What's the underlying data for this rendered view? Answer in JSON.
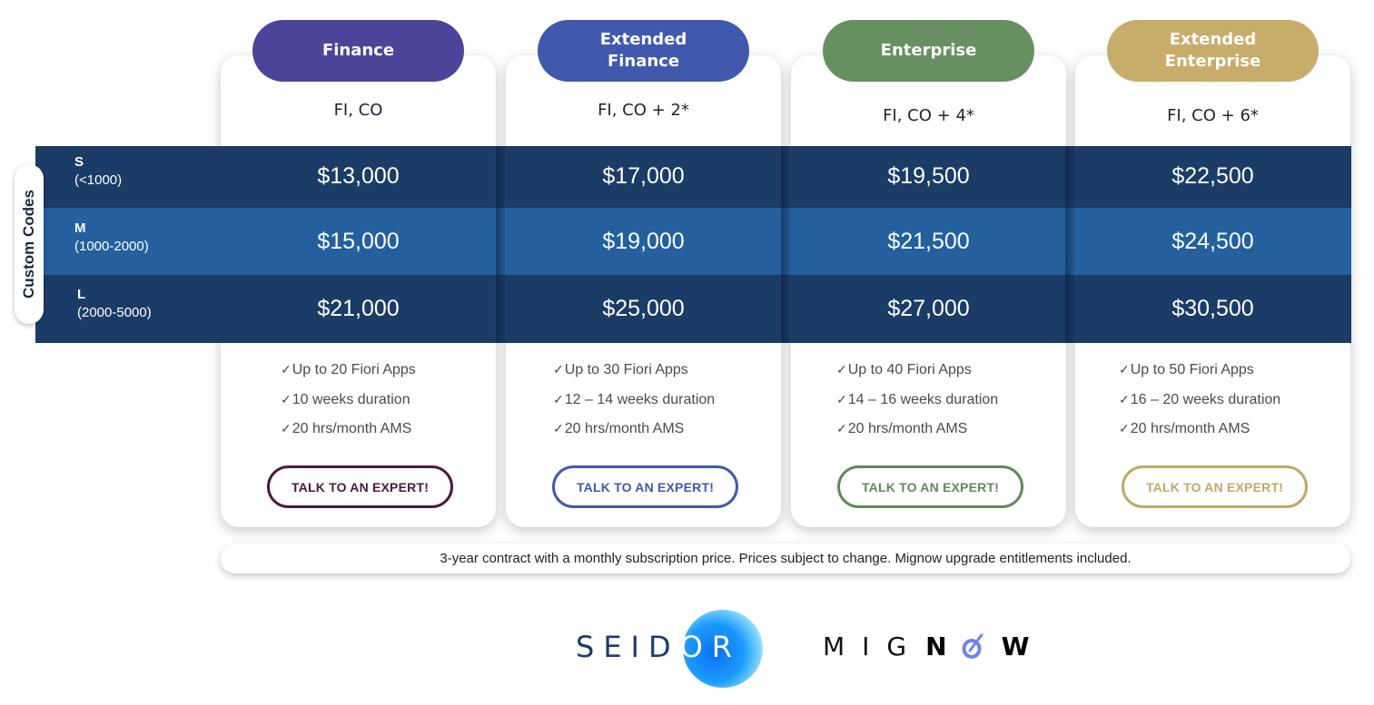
{
  "plans": [
    {
      "name": "Finance",
      "modules": "FI, CO",
      "color": "#4b459a",
      "prices": [
        "$13,000",
        "$15,000",
        "$21,000"
      ],
      "features": [
        "Up to 20 Fiori Apps",
        "10 weeks duration",
        "20 hrs/month AMS"
      ],
      "cta_label": "TALK TO AN EXPERT!",
      "cta_color": "#4a1a3f"
    },
    {
      "name": "Extended Finance",
      "modules": "FI, CO + 2*",
      "color": "#4059ad",
      "prices": [
        "$17,000",
        "$19,000",
        "$25,000"
      ],
      "features": [
        "Up to 30 Fiori Apps",
        "12 – 14 weeks duration",
        "20 hrs/month AMS"
      ],
      "cta_label": "TALK TO AN EXPERT!",
      "cta_color": "#4059ad"
    },
    {
      "name": "Enterprise",
      "modules": "FI, CO + 4*",
      "color": "#66905f",
      "prices": [
        "$19,500",
        "$21,500",
        "$27,000"
      ],
      "features": [
        "Up to 40 Fiori Apps",
        "14 – 16 weeks duration",
        "20 hrs/month AMS"
      ],
      "cta_label": "TALK TO AN EXPERT!",
      "cta_color": "#5f8a58"
    },
    {
      "name": "Extended Enterprise",
      "modules": "FI, CO + 6*",
      "color": "#c8ac6a",
      "prices": [
        "$22,500",
        "$24,500",
        "$30,500"
      ],
      "features": [
        "Up to 50 Fiori Apps",
        "16 – 20 weeks duration",
        "20 hrs/month AMS"
      ],
      "cta_label": "TALK TO AN EXPERT!",
      "cta_color": "#c2a867"
    }
  ],
  "side_label": "Custom Codes",
  "tiers": [
    {
      "code": "S",
      "range": "(<1000)"
    },
    {
      "code": "M",
      "range": "(1000-2000)"
    },
    {
      "code": "L",
      "range": "(2000-5000)"
    }
  ],
  "check_glyph": "✓",
  "footer_note": "3-year contract with a monthly subscription price. Prices subject to change. Mignow upgrade entitlements included.",
  "logos": {
    "seidor": {
      "pre": "SEID",
      "on_orb": "OR"
    },
    "mignow": {
      "pre": "MIG",
      "n": "N",
      "w": "W"
    }
  },
  "colors": {
    "band_dark": "#1a3c66",
    "band_light": "#24609d"
  }
}
